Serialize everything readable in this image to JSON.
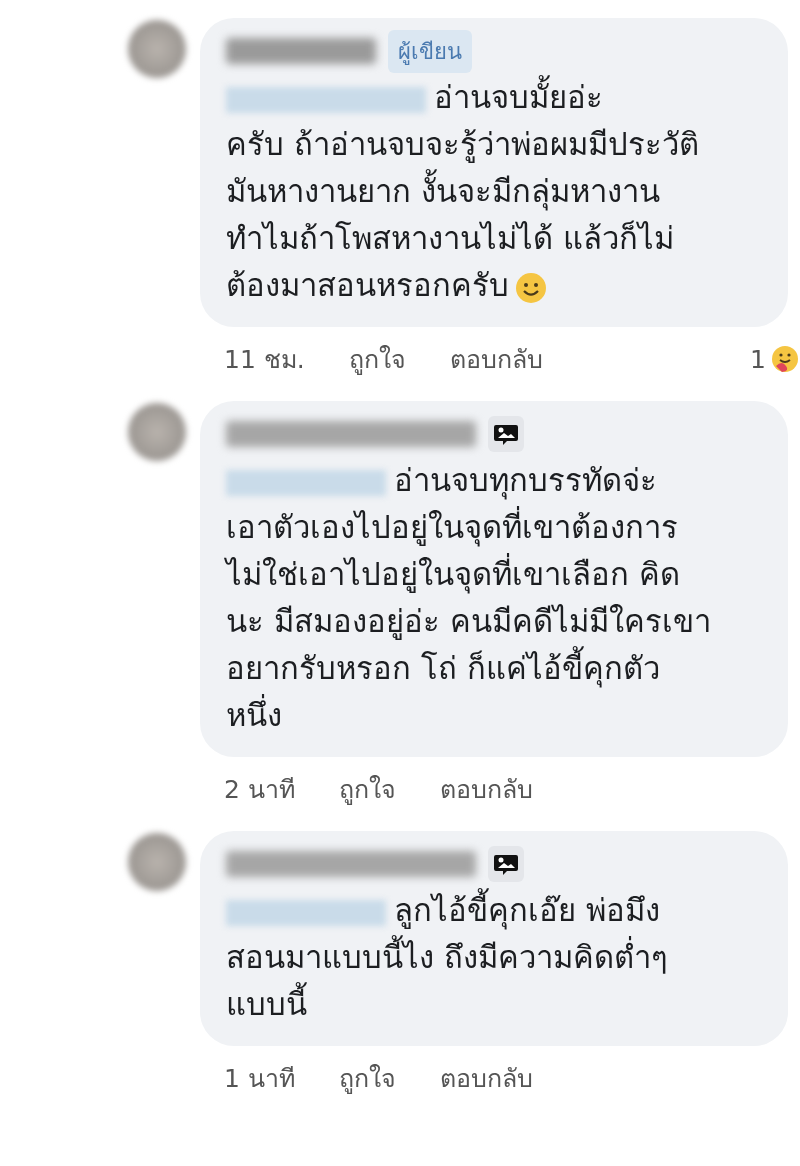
{
  "comments": [
    {
      "author_blurred": true,
      "badge": "ผู้เขียน",
      "photo_comment": false,
      "mention_blurred": true,
      "lines": [
        "อ่านจบมั้ยอ่ะ",
        "ครับ ถ้าอ่านจบจะรู้ว่าพ่อผมมีประวัติ",
        "มันหางานยาก งั้นจะมีกลุ่มหางาน",
        "ทำไมถ้าโพสหางานไม่ได้ แล้วก็ไม่",
        "ต้องมาสอนหรอกครับ"
      ],
      "ends_with_smiley": true,
      "time": "11 ชม.",
      "like": "ถูกใจ",
      "reply": "ตอบกลับ",
      "reaction_count": "1"
    },
    {
      "author_blurred": true,
      "photo_comment": true,
      "mention_blurred": true,
      "lines": [
        "อ่านจบทุกบรรทัดจ่ะ",
        "เอาตัวเองไปอยู่ในจุดที่เขาต้องการ",
        "ไม่ใช่เอาไปอยู่ในจุดที่เขาเลือก คิด",
        "นะ มีสมองอยู่อ่ะ คนมีคดีไม่มีใครเขา",
        "อยากรับหรอก โถ่ ก็แค่ไอ้ขี้คุกตัว",
        "หนึ่ง"
      ],
      "ends_with_smiley": false,
      "time": "2 นาที",
      "like": "ถูกใจ",
      "reply": "ตอบกลับ"
    },
    {
      "author_blurred": true,
      "photo_comment": true,
      "mention_blurred": true,
      "lines": [
        "ลูกไอ้ขี้คุกเอ๊ย พ่อมึง",
        "สอนมาแบบนี้ไง ถึงมีความคิดต่ำๆ",
        "แบบนี้"
      ],
      "ends_with_smiley": false,
      "time": "1 นาที",
      "like": "ถูกใจ",
      "reply": "ตอบกลับ"
    }
  ]
}
